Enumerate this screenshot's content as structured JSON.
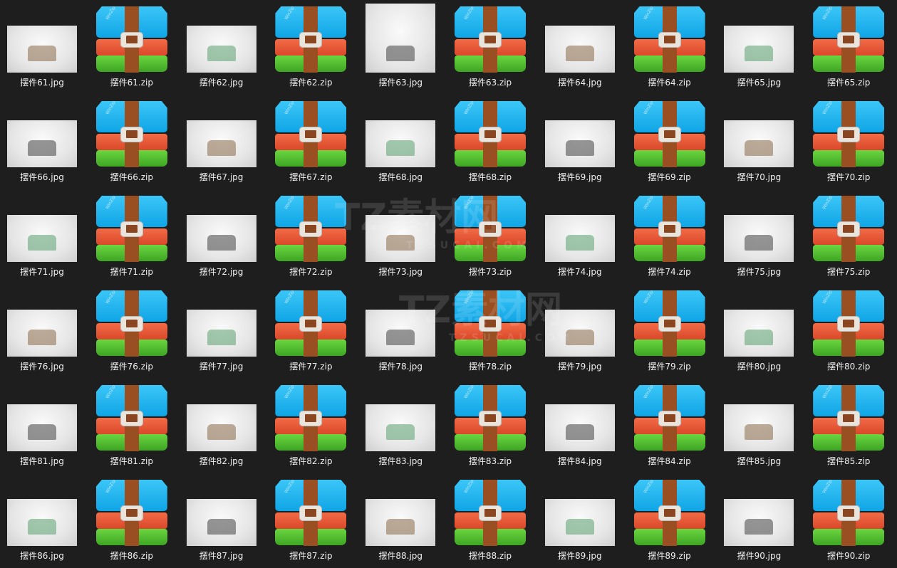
{
  "items": [
    {
      "name": "摆件61.jpg",
      "type": "jpg"
    },
    {
      "name": "摆件61.zip",
      "type": "zip"
    },
    {
      "name": "摆件62.jpg",
      "type": "jpg"
    },
    {
      "name": "摆件62.zip",
      "type": "zip"
    },
    {
      "name": "摆件63.jpg",
      "type": "jpg",
      "tall": true
    },
    {
      "name": "摆件63.zip",
      "type": "zip"
    },
    {
      "name": "摆件64.jpg",
      "type": "jpg"
    },
    {
      "name": "摆件64.zip",
      "type": "zip"
    },
    {
      "name": "摆件65.jpg",
      "type": "jpg"
    },
    {
      "name": "摆件65.zip",
      "type": "zip"
    },
    {
      "name": "摆件66.jpg",
      "type": "jpg"
    },
    {
      "name": "摆件66.zip",
      "type": "zip"
    },
    {
      "name": "摆件67.jpg",
      "type": "jpg"
    },
    {
      "name": "摆件67.zip",
      "type": "zip"
    },
    {
      "name": "摆件68.jpg",
      "type": "jpg"
    },
    {
      "name": "摆件68.zip",
      "type": "zip"
    },
    {
      "name": "摆件69.jpg",
      "type": "jpg"
    },
    {
      "name": "摆件69.zip",
      "type": "zip"
    },
    {
      "name": "摆件70.jpg",
      "type": "jpg"
    },
    {
      "name": "摆件70.zip",
      "type": "zip"
    },
    {
      "name": "摆件71.jpg",
      "type": "jpg"
    },
    {
      "name": "摆件71.zip",
      "type": "zip"
    },
    {
      "name": "摆件72.jpg",
      "type": "jpg"
    },
    {
      "name": "摆件72.zip",
      "type": "zip"
    },
    {
      "name": "摆件73.jpg",
      "type": "jpg"
    },
    {
      "name": "摆件73.zip",
      "type": "zip"
    },
    {
      "name": "摆件74.jpg",
      "type": "jpg"
    },
    {
      "name": "摆件74.zip",
      "type": "zip"
    },
    {
      "name": "摆件75.jpg",
      "type": "jpg"
    },
    {
      "name": "摆件75.zip",
      "type": "zip"
    },
    {
      "name": "摆件76.jpg",
      "type": "jpg"
    },
    {
      "name": "摆件76.zip",
      "type": "zip"
    },
    {
      "name": "摆件77.jpg",
      "type": "jpg"
    },
    {
      "name": "摆件77.zip",
      "type": "zip"
    },
    {
      "name": "摆件78.jpg",
      "type": "jpg"
    },
    {
      "name": "摆件78.zip",
      "type": "zip"
    },
    {
      "name": "摆件79.jpg",
      "type": "jpg"
    },
    {
      "name": "摆件79.zip",
      "type": "zip"
    },
    {
      "name": "摆件80.jpg",
      "type": "jpg"
    },
    {
      "name": "摆件80.zip",
      "type": "zip"
    },
    {
      "name": "摆件81.jpg",
      "type": "jpg"
    },
    {
      "name": "摆件81.zip",
      "type": "zip"
    },
    {
      "name": "摆件82.jpg",
      "type": "jpg"
    },
    {
      "name": "摆件82.zip",
      "type": "zip"
    },
    {
      "name": "摆件83.jpg",
      "type": "jpg"
    },
    {
      "name": "摆件83.zip",
      "type": "zip"
    },
    {
      "name": "摆件84.jpg",
      "type": "jpg"
    },
    {
      "name": "摆件84.zip",
      "type": "zip"
    },
    {
      "name": "摆件85.jpg",
      "type": "jpg"
    },
    {
      "name": "摆件85.zip",
      "type": "zip"
    },
    {
      "name": "摆件86.jpg",
      "type": "jpg"
    },
    {
      "name": "摆件86.zip",
      "type": "zip"
    },
    {
      "name": "摆件87.jpg",
      "type": "jpg"
    },
    {
      "name": "摆件87.zip",
      "type": "zip"
    },
    {
      "name": "摆件88.jpg",
      "type": "jpg"
    },
    {
      "name": "摆件88.zip",
      "type": "zip"
    },
    {
      "name": "摆件89.jpg",
      "type": "jpg"
    },
    {
      "name": "摆件89.zip",
      "type": "zip"
    },
    {
      "name": "摆件90.jpg",
      "type": "jpg"
    },
    {
      "name": "摆件90.zip",
      "type": "zip"
    }
  ],
  "zip_brand": "WinZip",
  "watermark": {
    "title": "TZ素材网",
    "subtitle": "TZSUCAI.COM"
  },
  "colors": {
    "background": "#1e1e1e",
    "label": "#f0f0f0"
  }
}
